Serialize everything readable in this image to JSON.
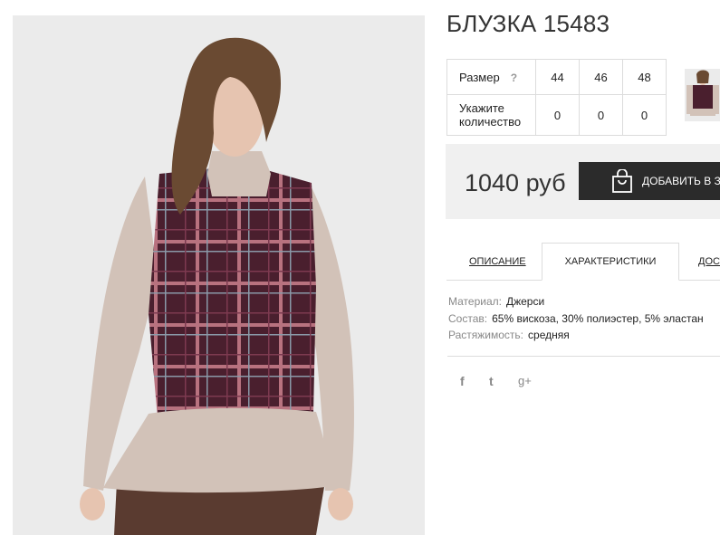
{
  "product": {
    "title": "БЛУЗКА 15483",
    "image_alt": "Блузка",
    "price": "1040 руб",
    "add_to_cart_label": "ДОБАВИТЬ В ЗА"
  },
  "size_table": {
    "size_label": "Размер",
    "help_icon": "?",
    "qty_label_line1": "Укажите",
    "qty_label_line2": "количество",
    "sizes": [
      "44",
      "46",
      "48"
    ],
    "quantities": [
      "0",
      "0",
      "0"
    ]
  },
  "tabs": [
    {
      "label": "ОПИСАНИЕ",
      "active": false
    },
    {
      "label": "ХАРАКТЕРИСТИКИ",
      "active": true
    },
    {
      "label": "ДОСТ",
      "active": false
    }
  ],
  "specs": [
    {
      "key": "Материал:",
      "value": "Джерси"
    },
    {
      "key": "Состав:",
      "value": "65% вискоза, 30% полиэстер, 5% эластан"
    },
    {
      "key": "Растяжимость:",
      "value": "средняя"
    }
  ],
  "social": [
    "f",
    "t",
    "g+"
  ],
  "colors": {
    "accent_button": "#2b2b2b",
    "price_box": "#f0f0f0",
    "plaid": "#4a1f2e",
    "sleeve": "#d2c2b8"
  }
}
